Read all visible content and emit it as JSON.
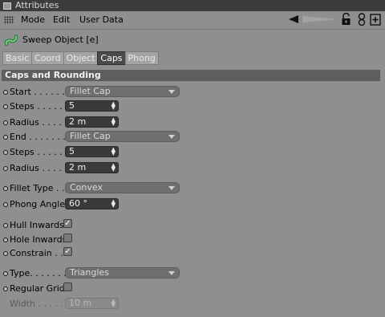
{
  "window": {
    "title": "Attributes"
  },
  "menu": {
    "mode": "Mode",
    "edit": "Edit",
    "user_data": "User Data"
  },
  "object": {
    "title": "Sweep Object [e]"
  },
  "tabs": [
    "Basic",
    "Coord",
    "Object",
    "Caps",
    "Phong"
  ],
  "section": {
    "title": "Caps and Rounding"
  },
  "fields": {
    "start": {
      "label": "Start . . . . . . . .",
      "value": "Fillet Cap"
    },
    "steps1": {
      "label": "Steps . . . . . . .",
      "value": "5"
    },
    "radius1": {
      "label": "Radius . . . . . .",
      "value": "2 m"
    },
    "end": {
      "label": "End . . . . . . . .",
      "value": "Fillet Cap"
    },
    "steps2": {
      "label": "Steps . . . . . . .",
      "value": "5"
    },
    "radius2": {
      "label": "Radius . . . . . .",
      "value": "2 m"
    },
    "fillet_type": {
      "label": "Fillet Type . . .",
      "value": "Convex"
    },
    "phong_angle": {
      "label": "Phong Angle",
      "value": "60 °"
    },
    "hull_inwards": {
      "label": "Hull Inwards",
      "checked": true
    },
    "hole_inwards": {
      "label": "Hole Inwards",
      "checked": false
    },
    "constrain": {
      "label": "Constrain . . .",
      "checked": true
    },
    "type": {
      "label": "Type. . . . . . . .",
      "value": "Triangles"
    },
    "regular_grid": {
      "label": "Regular Grid",
      "checked": false
    },
    "width": {
      "label": "Width . . . . . . .",
      "value": "10 m"
    }
  },
  "colors": {
    "panel_bg": "#8f8f8f",
    "header_bg": "#5e5e5e",
    "active_tab": "#4a4a4a",
    "field_bg": "#3a3a3a"
  }
}
